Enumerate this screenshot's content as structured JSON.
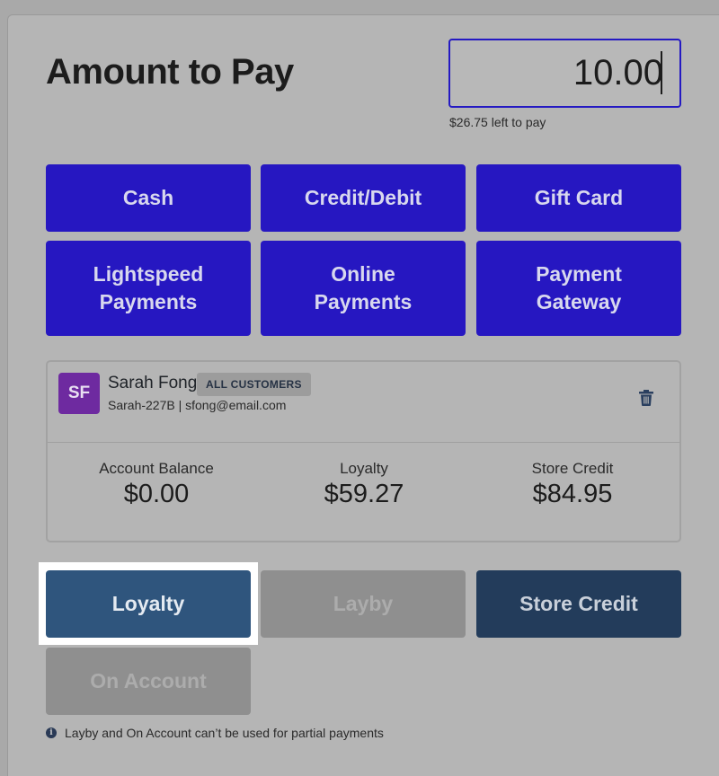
{
  "header": {
    "title": "Amount to Pay",
    "amount_value": "10.00",
    "left_to_pay": "$26.75 left to pay"
  },
  "payment_methods": [
    {
      "line1": "Cash",
      "line2": ""
    },
    {
      "line1": "Credit/Debit",
      "line2": ""
    },
    {
      "line1": "Gift Card",
      "line2": ""
    },
    {
      "line1": "Lightspeed",
      "line2": "Payments"
    },
    {
      "line1": "Online",
      "line2": "Payments"
    },
    {
      "line1": "Payment",
      "line2": "Gateway"
    }
  ],
  "customer": {
    "initials": "SF",
    "name": "Sarah Fong",
    "group_badge": "ALL CUSTOMERS",
    "details": "Sarah-227B | sfong@email.com",
    "avatar_color": "#6e2aa0",
    "delete_icon": "trash-icon",
    "stats": [
      {
        "label": "Account Balance",
        "value": "$0.00"
      },
      {
        "label": "Loyalty",
        "value": "$59.27"
      },
      {
        "label": "Store Credit",
        "value": "$84.95"
      }
    ]
  },
  "tenders": {
    "loyalty": "Loyalty",
    "layby": "Layby",
    "store_credit": "Store Credit",
    "on_account": "On Account"
  },
  "note": {
    "icon": "info-icon",
    "text": "Layby and On Account can’t be used for partial payments"
  },
  "colors": {
    "accent": "#2617c1",
    "loyalty_button": "#2f557d",
    "store_credit_button": "#233c5b",
    "disabled_button": "#8f8f8f"
  }
}
